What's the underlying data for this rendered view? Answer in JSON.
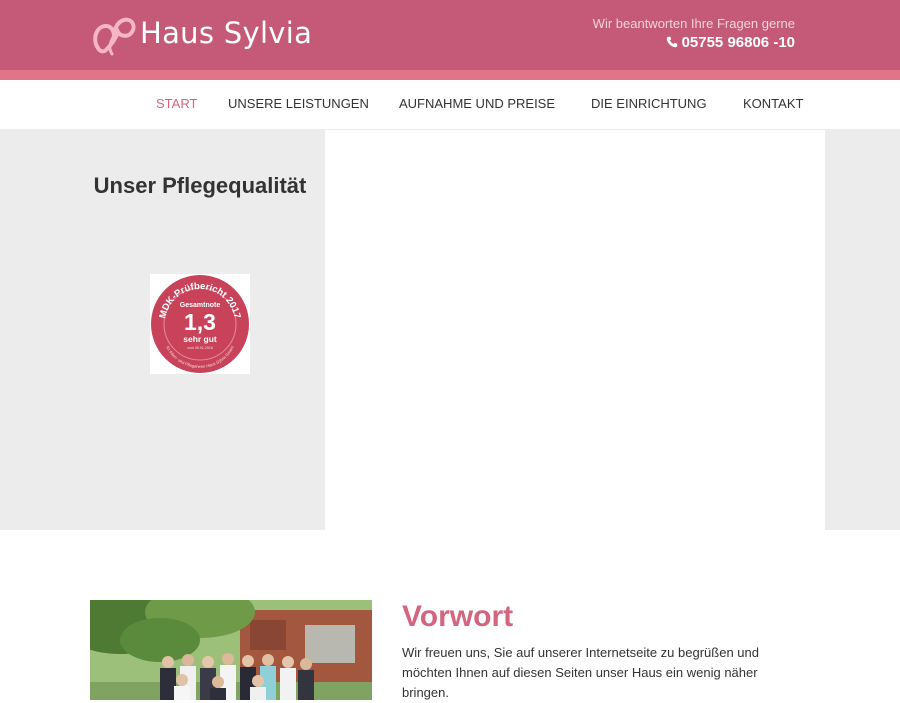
{
  "header": {
    "brand": "Haus Sylvia",
    "tagline": "Wir beantworten Ihre Fragen gerne",
    "phone": "05755 96806 -10"
  },
  "nav": {
    "items": [
      {
        "label": "START",
        "active": true
      },
      {
        "label": "UNSERE LEISTUNGEN",
        "active": false
      },
      {
        "label": "AUFNAHME UND PREISE",
        "active": false
      },
      {
        "label": "DIE EINRICHTUNG",
        "active": false
      },
      {
        "label": "KONTAKT",
        "active": false
      }
    ]
  },
  "quality": {
    "heading": "Unser Pflegequalität",
    "seal": {
      "title": "MDK-Prüfbericht 2017",
      "label": "Gesamtnote",
      "grade": "1,3",
      "rating": "sehr gut",
      "date": "vom 05.01.2018",
      "issuer": "für Alten- und Pflegeheim Haus Sylvia GmbH"
    }
  },
  "intro": {
    "heading": "Vorwort",
    "text": "Wir freuen uns, Sie auf unserer Internetseite zu begrüßen und möchten Ihnen auf diesen Seiten unser Haus ein wenig näher bringen."
  },
  "colors": {
    "header_bg": "#c45a78",
    "header_stripe": "#e07488",
    "accent": "#d4657f",
    "panel_bg": "#ececec",
    "seal_red": "#c8425a"
  },
  "icons": {
    "logo": "heart-ribbon-icon",
    "phone": "phone-icon"
  }
}
